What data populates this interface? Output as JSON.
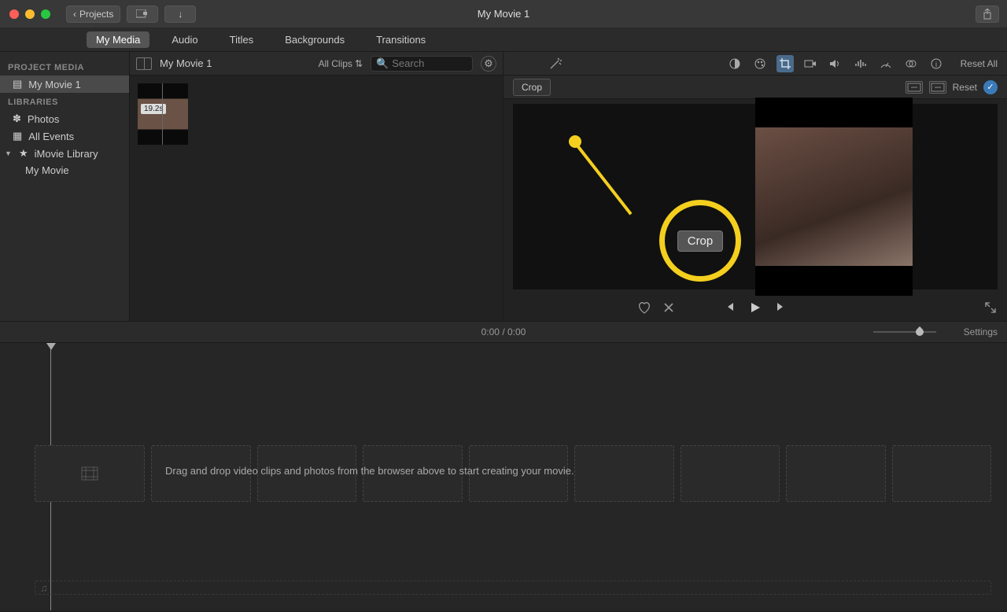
{
  "window": {
    "title": "My Movie 1",
    "back_label": "Projects"
  },
  "tabs": {
    "my_media": "My Media",
    "audio": "Audio",
    "titles": "Titles",
    "backgrounds": "Backgrounds",
    "transitions": "Transitions"
  },
  "sidebar": {
    "project_media_header": "PROJECT MEDIA",
    "project_name": "My Movie 1",
    "libraries_header": "LIBRARIES",
    "photos": "Photos",
    "all_events": "All Events",
    "imovie_library": "iMovie Library",
    "my_movie": "My Movie"
  },
  "browser": {
    "title": "My Movie 1",
    "clips_filter": "All Clips",
    "search_placeholder": "Search",
    "clip_duration": "19.2s"
  },
  "viewer": {
    "reset_all": "Reset All",
    "crop_label": "Crop",
    "reset_label": "Reset",
    "callout_label": "Crop"
  },
  "timeline": {
    "time_current": "0:00",
    "time_total": "0:00",
    "settings": "Settings",
    "hint": "Drag and drop video clips and photos from the browser above to start creating your movie."
  }
}
